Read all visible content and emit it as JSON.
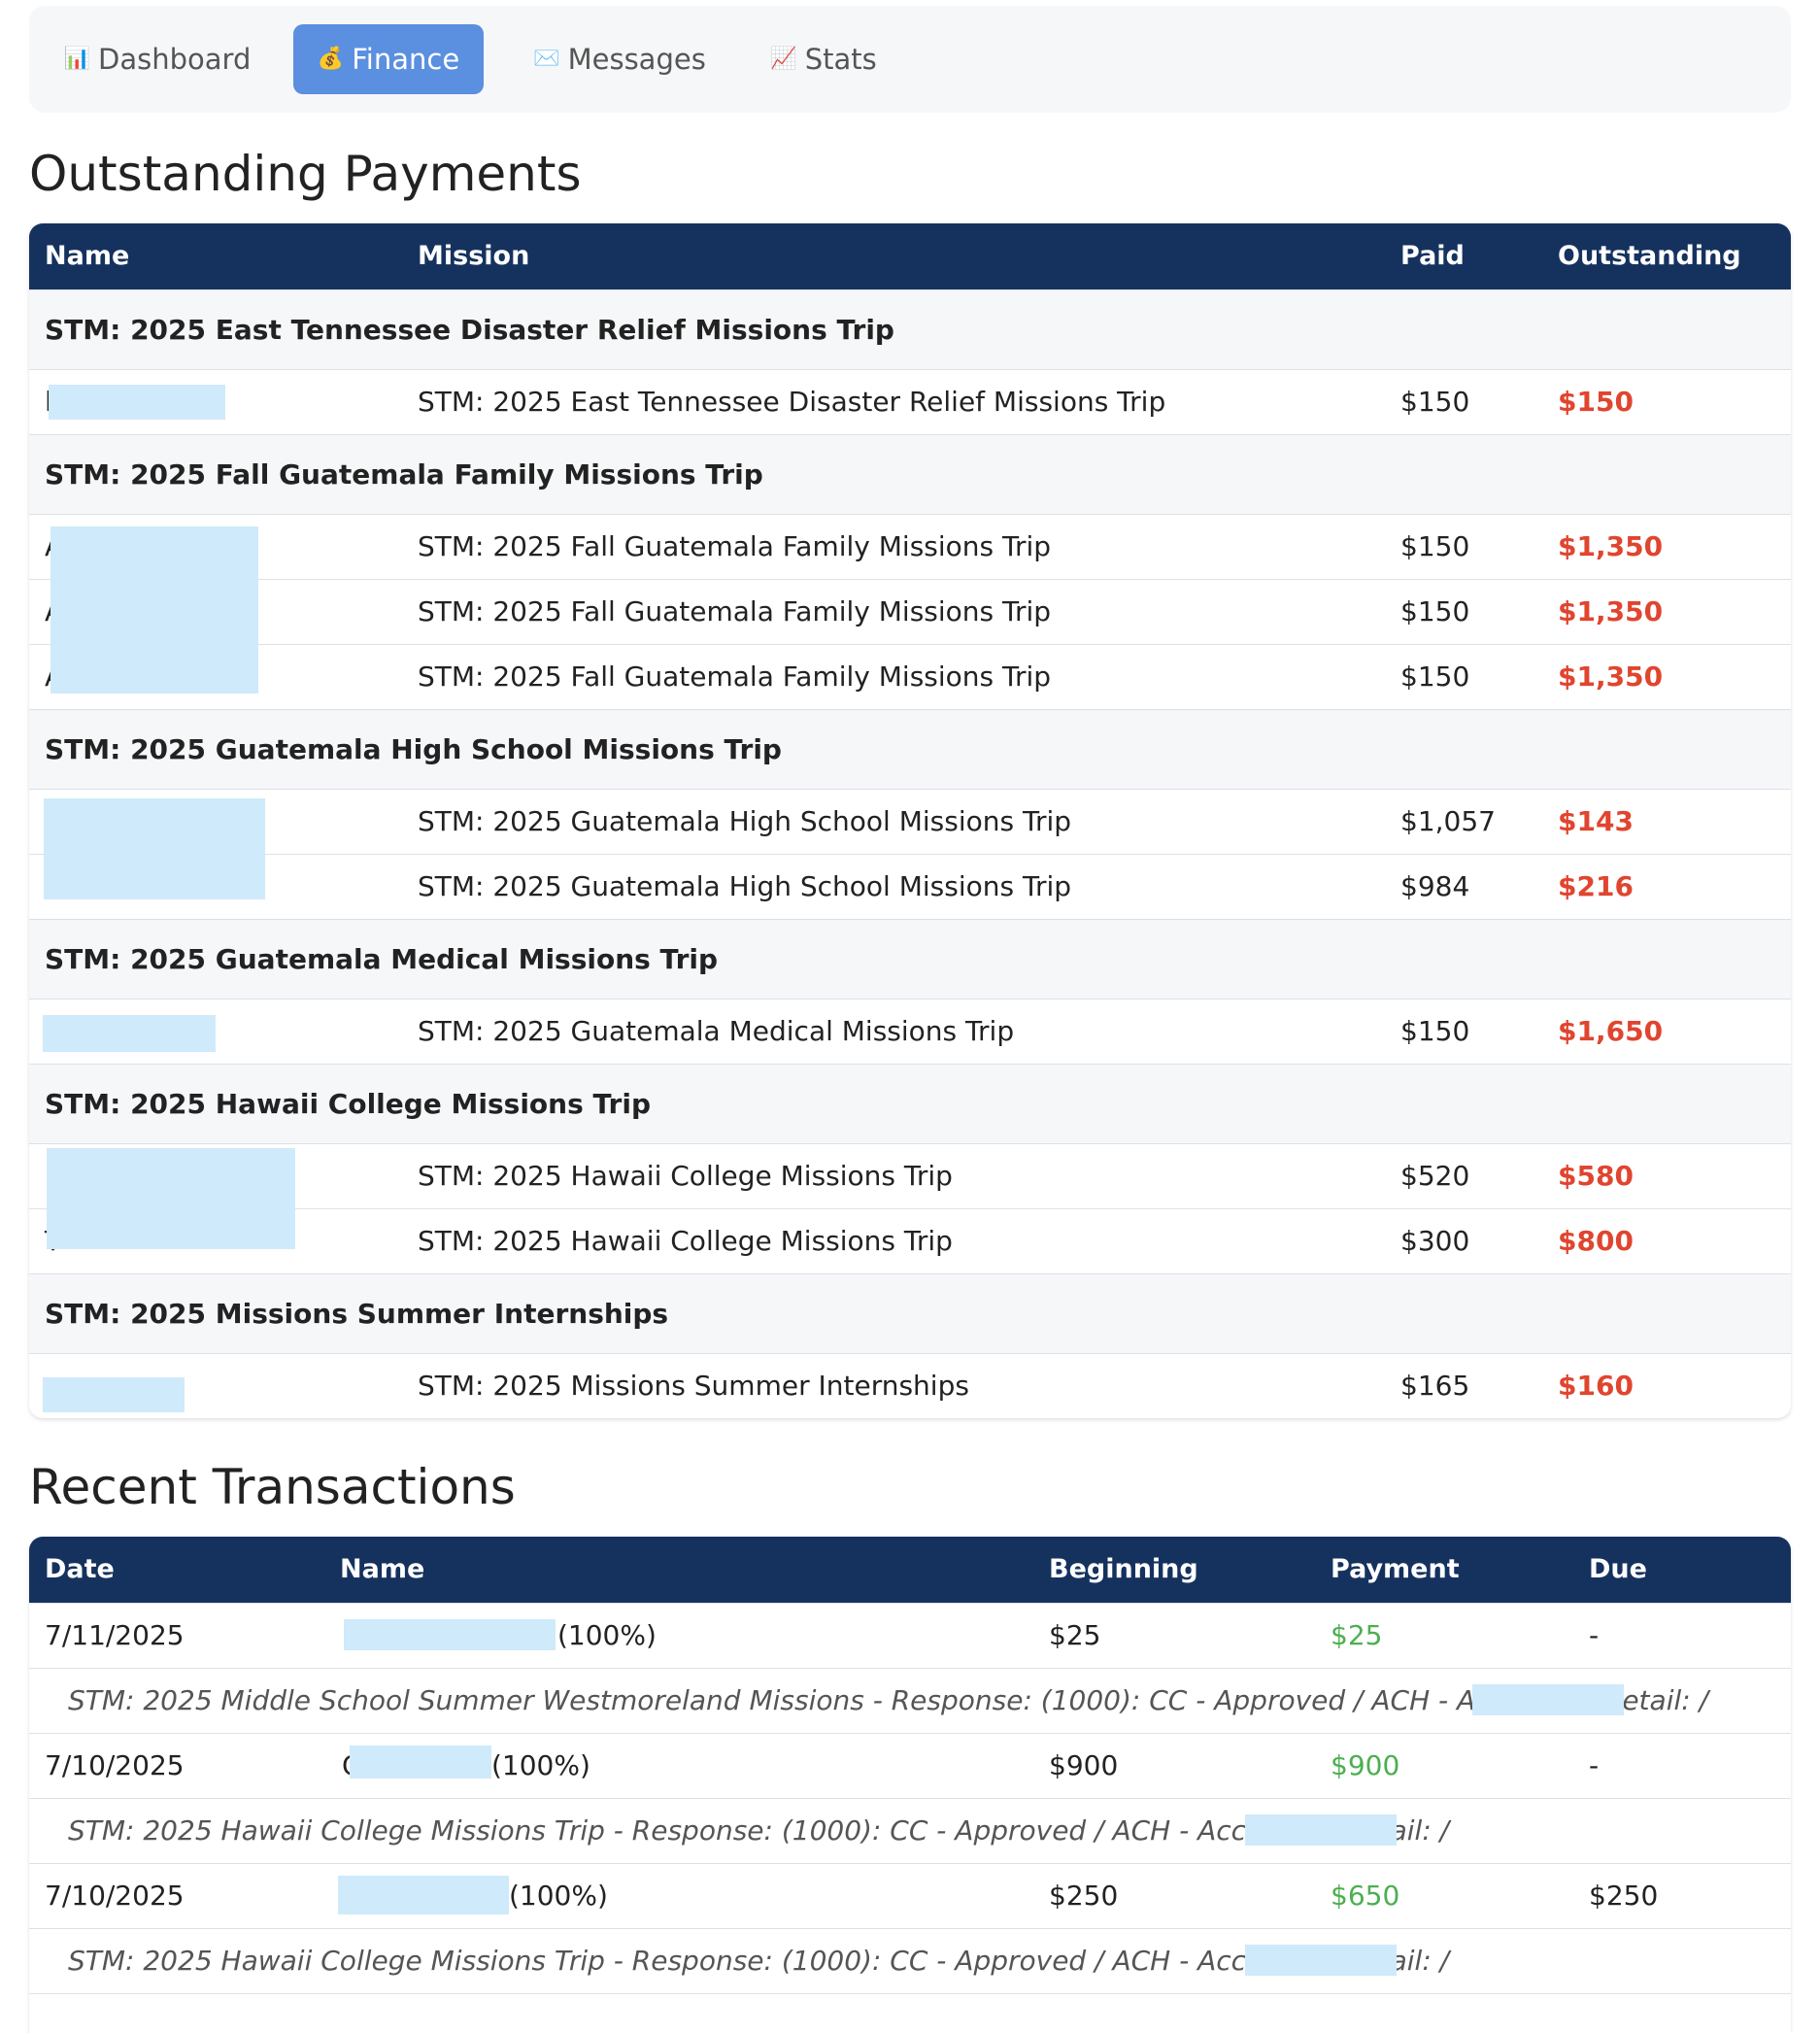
{
  "tabs": [
    {
      "label": "Dashboard",
      "icon": "📊",
      "active": false
    },
    {
      "label": "Finance",
      "icon": "💰",
      "active": true
    },
    {
      "label": "Messages",
      "icon": "✉️",
      "active": false
    },
    {
      "label": "Stats",
      "icon": "📈",
      "active": false
    }
  ],
  "outstanding": {
    "title": "Outstanding Payments",
    "headers": {
      "name": "Name",
      "mission": "Mission",
      "paid": "Paid",
      "outstanding": "Outstanding"
    },
    "groups": [
      {
        "title": "STM: 2025 East Tennessee Disaster Relief Missions Trip",
        "rows": [
          {
            "name": "l",
            "mission": "STM: 2025 East Tennessee Disaster Relief Missions Trip",
            "paid": "$150",
            "outstanding": "$150"
          }
        ]
      },
      {
        "title": "STM: 2025 Fall Guatemala Family Missions Trip",
        "rows": [
          {
            "name": "A y",
            "mission": "STM: 2025 Fall Guatemala Family Missions Trip",
            "paid": "$150",
            "outstanding": "$1,350"
          },
          {
            "name": "A",
            "mission": "STM: 2025 Fall Guatemala Family Missions Trip",
            "paid": "$150",
            "outstanding": "$1,350"
          },
          {
            "name": "A",
            "mission": "STM: 2025 Fall Guatemala Family Missions Trip",
            "paid": "$150",
            "outstanding": "$1,350"
          }
        ]
      },
      {
        "title": "STM: 2025 Guatemala High School Missions Trip",
        "rows": [
          {
            "name": "",
            "mission": "STM: 2025 Guatemala High School Missions Trip",
            "paid": "$1,057",
            "outstanding": "$143"
          },
          {
            "name": "",
            "mission": "STM: 2025 Guatemala High School Missions Trip",
            "paid": "$984",
            "outstanding": "$216"
          }
        ]
      },
      {
        "title": "STM: 2025 Guatemala Medical Missions Trip",
        "rows": [
          {
            "name": "",
            "mission": "STM: 2025 Guatemala Medical Missions Trip",
            "paid": "$150",
            "outstanding": "$1,650"
          }
        ]
      },
      {
        "title": "STM: 2025 Hawaii College Missions Trip",
        "rows": [
          {
            "name": "l",
            "mission": "STM: 2025 Hawaii College Missions Trip",
            "paid": "$520",
            "outstanding": "$580"
          },
          {
            "name": "T",
            "mission": "STM: 2025 Hawaii College Missions Trip",
            "paid": "$300",
            "outstanding": "$800"
          }
        ]
      },
      {
        "title": "STM: 2025 Missions Summer Internships",
        "rows": [
          {
            "name": "",
            "mission": "STM: 2025 Missions Summer Internships",
            "paid": "$165",
            "outstanding": "$160"
          }
        ]
      }
    ]
  },
  "transactions": {
    "title": "Recent Transactions",
    "headers": {
      "date": "Date",
      "name": "Name",
      "beginning": "Beginning",
      "payment": "Payment",
      "due": "Due"
    },
    "rows": [
      {
        "date": "7/11/2025",
        "name_prefix": "l",
        "name_suffix": "(100%)",
        "beginning": "$25",
        "payment": "$25",
        "due": "-",
        "detail": "STM: 2025 Middle School Summer Westmoreland Missions - Response: (1000): CC - Approved / ACH - Accepted, Detail: /"
      },
      {
        "date": "7/10/2025",
        "name_prefix": "C",
        "name_suffix": "(100%)",
        "beginning": "$900",
        "payment": "$900",
        "due": "-",
        "detail": "STM: 2025 Hawaii College Missions Trip - Response: (1000): CC - Approved / ACH - Accepted, Detail: /"
      },
      {
        "date": "7/10/2025",
        "name_prefix": "",
        "name_suffix": "(100%)",
        "beginning": "$250",
        "payment": "$650",
        "due": "$250",
        "detail": "STM: 2025 Hawaii College Missions Trip - Response: (1000): CC - Approved / ACH - Accepted, Detail: /"
      }
    ]
  },
  "colors": {
    "header": "#15325f",
    "accent": "#5b8fdf",
    "outstanding": "#e0452f",
    "payment": "#4caf50",
    "redaction": "#cfeafa"
  }
}
